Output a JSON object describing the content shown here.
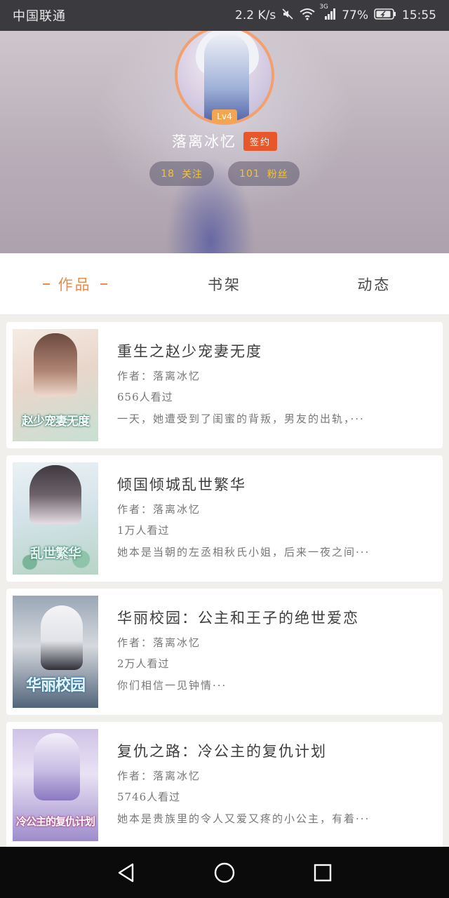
{
  "status_bar": {
    "carrier": "中国联通",
    "net_speed": "2.2 K/s",
    "network_type": "3G",
    "battery": "77%",
    "time": "15:55",
    "icons": [
      "mute-icon",
      "wifi-icon",
      "signal-icon",
      "battery-icon"
    ]
  },
  "profile": {
    "level": "Lv4",
    "username": "落离冰忆",
    "sign_badge": "签约",
    "following_count": "18",
    "following_label": "关注",
    "followers_count": "101",
    "followers_label": "粉丝",
    "accent": "#f3a070"
  },
  "tabs": [
    {
      "label": "作品",
      "active": true
    },
    {
      "label": "书架",
      "active": false
    },
    {
      "label": "动态",
      "active": false
    }
  ],
  "books": [
    {
      "title": "重生之赵少宠妻无度",
      "author": "作者：落离冰忆",
      "views": "656人看过",
      "desc": "一天，她遭受到了闺蜜的背叛，男友的出轨，···",
      "cover_text": "赵少宠妻无度",
      "cover_colors": [
        "#f3e6dc",
        "#c9e0d4"
      ]
    },
    {
      "title": "倾国倾城乱世繁华",
      "author": "作者：落离冰忆",
      "views": "1万人看过",
      "desc": "她本是当朝的左丞相秋氏小姐，后来一夜之间···",
      "cover_text": "乱世繁华",
      "cover_colors": [
        "#e3ecf2",
        "#b9cfc8"
      ]
    },
    {
      "title": "华丽校园：公主和王子的绝世爱恋",
      "author": "作者：落离冰忆",
      "views": "2万人看过",
      "desc": "你们相信一见钟情···",
      "cover_text": "华丽校园",
      "cover_colors": [
        "#bfc4cc",
        "#5c6f86"
      ]
    },
    {
      "title": "复仇之路：冷公主的复仇计划",
      "author": "作者：落离冰忆",
      "views": "5746人看过",
      "desc": "她本是贵族里的令人又爱又疼的小公主，有着···",
      "cover_text": "冷公主的复仇计划",
      "cover_colors": [
        "#d9cdeb",
        "#8f7fc0"
      ]
    }
  ],
  "nav": {
    "back_icon": "back-triangle-icon",
    "home_icon": "home-circle-icon",
    "recents_icon": "recents-square-icon"
  }
}
